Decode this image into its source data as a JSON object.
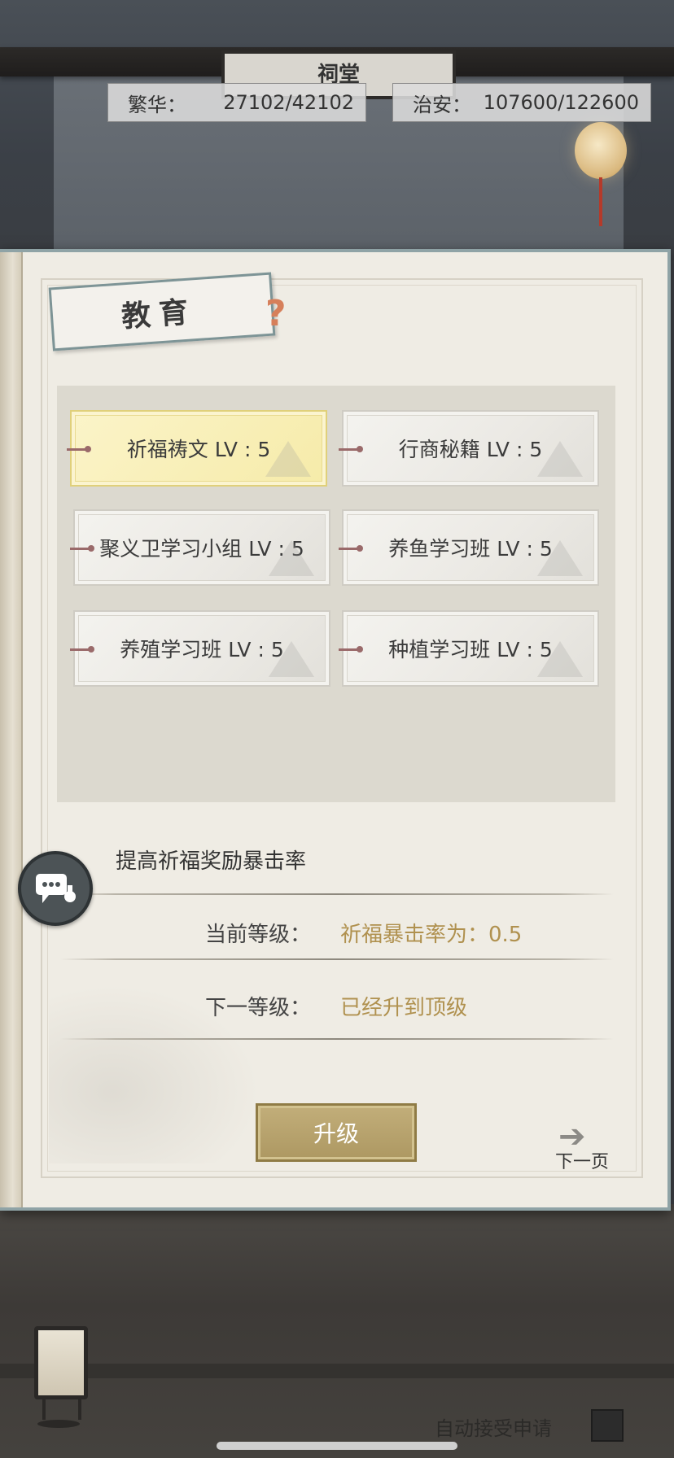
{
  "background": {
    "board_title": "祠堂"
  },
  "stats": {
    "prosperity": {
      "label": "繁华：",
      "value": "27102/42102"
    },
    "security": {
      "label": "治安：",
      "value": "107600/122600"
    }
  },
  "panel": {
    "title": "教育",
    "help_icon": "?",
    "skills": [
      {
        "label": "祈福祷文 LV : 5",
        "selected": true
      },
      {
        "label": "行商秘籍 LV : 5",
        "selected": false
      },
      {
        "label": "聚义卫学习小组 LV : 5",
        "selected": false
      },
      {
        "label": "养鱼学习班 LV : 5",
        "selected": false
      },
      {
        "label": "养殖学习班 LV : 5",
        "selected": false
      },
      {
        "label": "种植学习班 LV : 5",
        "selected": false
      }
    ],
    "description": "提高祈福奖励暴击率",
    "current_level": {
      "label": "当前等级：",
      "value": "祈福暴击率为：0.5"
    },
    "next_level": {
      "label": "下一等级：",
      "value": "已经升到顶级"
    },
    "upgrade_button": "升级",
    "next_page": "下一页"
  },
  "footer": {
    "auto_accept_label": "自动接受申请"
  },
  "colors": {
    "accent_gold": "#b0914f",
    "selected_card": "#f6eba9",
    "frame_teal": "#8fa3a6"
  }
}
